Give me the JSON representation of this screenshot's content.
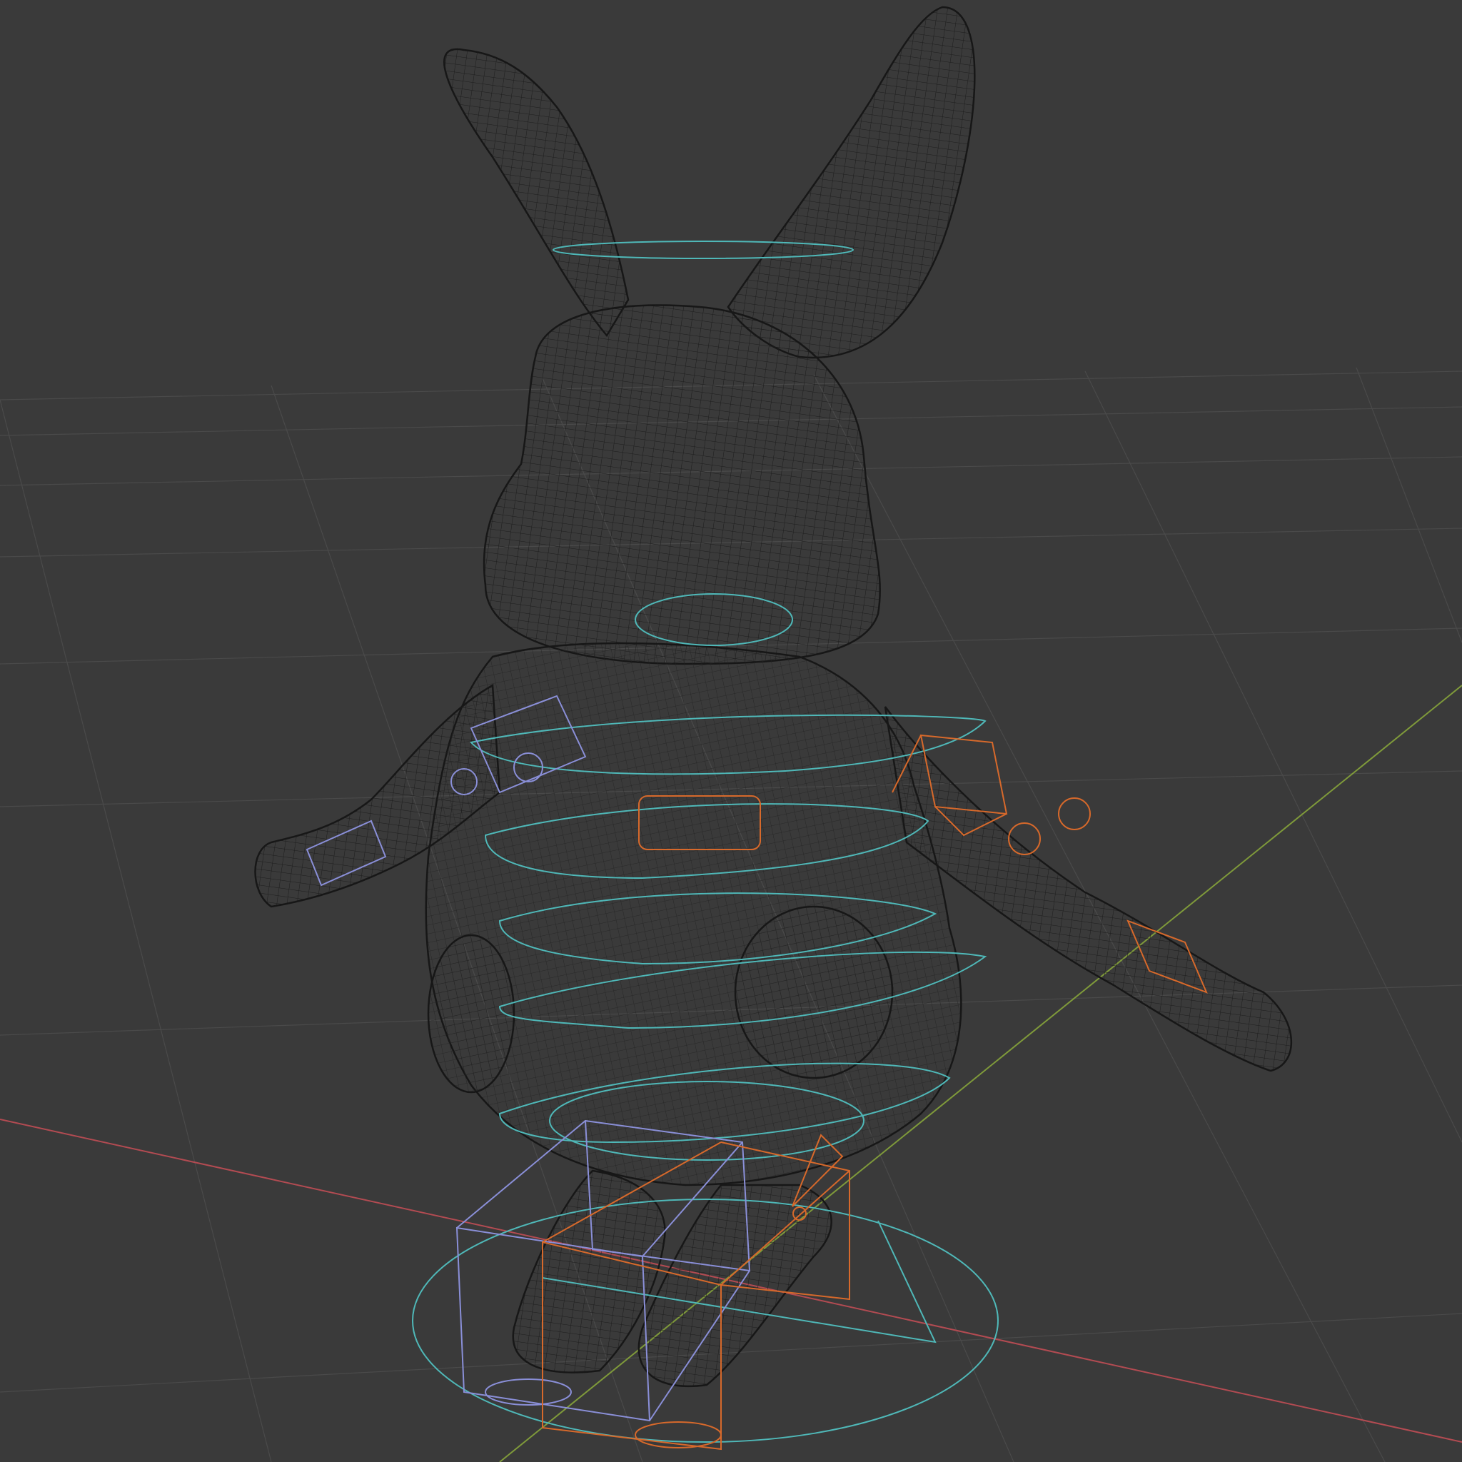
{
  "viewport": {
    "background_color": "#3a3a3a",
    "shading_mode": "wireframe",
    "object": "rabbit-character",
    "colors": {
      "grid": "#4a4a4a",
      "axis_x": "#b34b52",
      "axis_y": "#7f9a3a",
      "mesh_wire": "#1c1c1c",
      "mesh_fill": "#313131",
      "controls_center": "#4fb8b8",
      "controls_left": "#8a8fd8",
      "controls_right": "#d7692b"
    }
  }
}
